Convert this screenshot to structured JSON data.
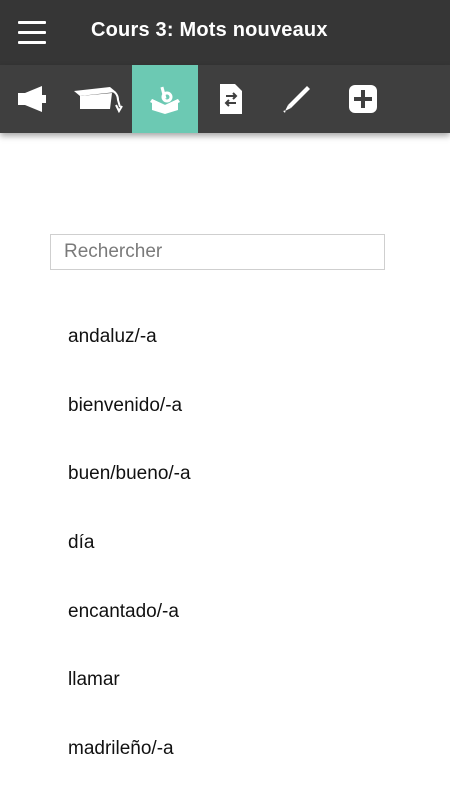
{
  "header": {
    "title": "Cours 3: Mots nouveaux",
    "menu_icon": "hamburger-menu-icon"
  },
  "toolbar": {
    "active_color": "#6cc9b3",
    "background": "#3f3f3f",
    "tools": [
      {
        "icon": "megaphone-icon",
        "active": false
      },
      {
        "icon": "graduation-cap-icon",
        "active": false
      },
      {
        "icon": "vocabulary-box-icon",
        "active": true
      },
      {
        "icon": "translate-document-icon",
        "active": false
      },
      {
        "icon": "pen-icon",
        "active": false
      },
      {
        "icon": "add-square-icon",
        "active": false
      }
    ]
  },
  "search": {
    "placeholder": "Rechercher",
    "value": ""
  },
  "words": [
    "andaluz/-a",
    "bienvenido/-a",
    "buen/bueno/-a",
    "día",
    "encantado/-a",
    "llamar",
    "madrileño/-a"
  ]
}
